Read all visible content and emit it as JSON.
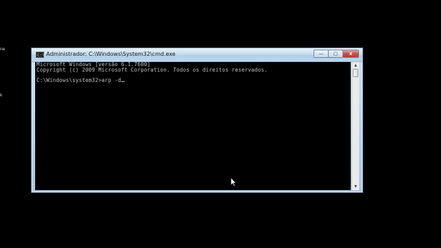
{
  "desktop": {
    "fragments": [
      "ne",
      "k"
    ]
  },
  "window": {
    "title": "Administrador: C:\\Windows\\System32\\cmd.exe",
    "icon_glyph": "C:\\",
    "buttons": {
      "minimize_glyph": "—",
      "maximize_glyph": "▢",
      "close_glyph": "x"
    }
  },
  "console": {
    "lines": [
      "Microsoft Windows [versão 6.1.7600]",
      "Copyright (c) 2009 Microsoft Corporation. Todos os direitos reservados.",
      "",
      "C:\\Windows\\system32>arp -d"
    ]
  },
  "scrollbar": {
    "up_glyph": "▲",
    "down_glyph": "▼"
  },
  "colors": {
    "console_bg": "#000000",
    "console_text": "#c0c0c0",
    "desktop_bg": "#000000",
    "close_button": "#c75050"
  },
  "icons": [
    "cmd-app-icon",
    "minimize-icon",
    "maximize-icon",
    "close-icon",
    "scroll-up-icon",
    "scroll-down-icon",
    "mouse-pointer-icon"
  ]
}
